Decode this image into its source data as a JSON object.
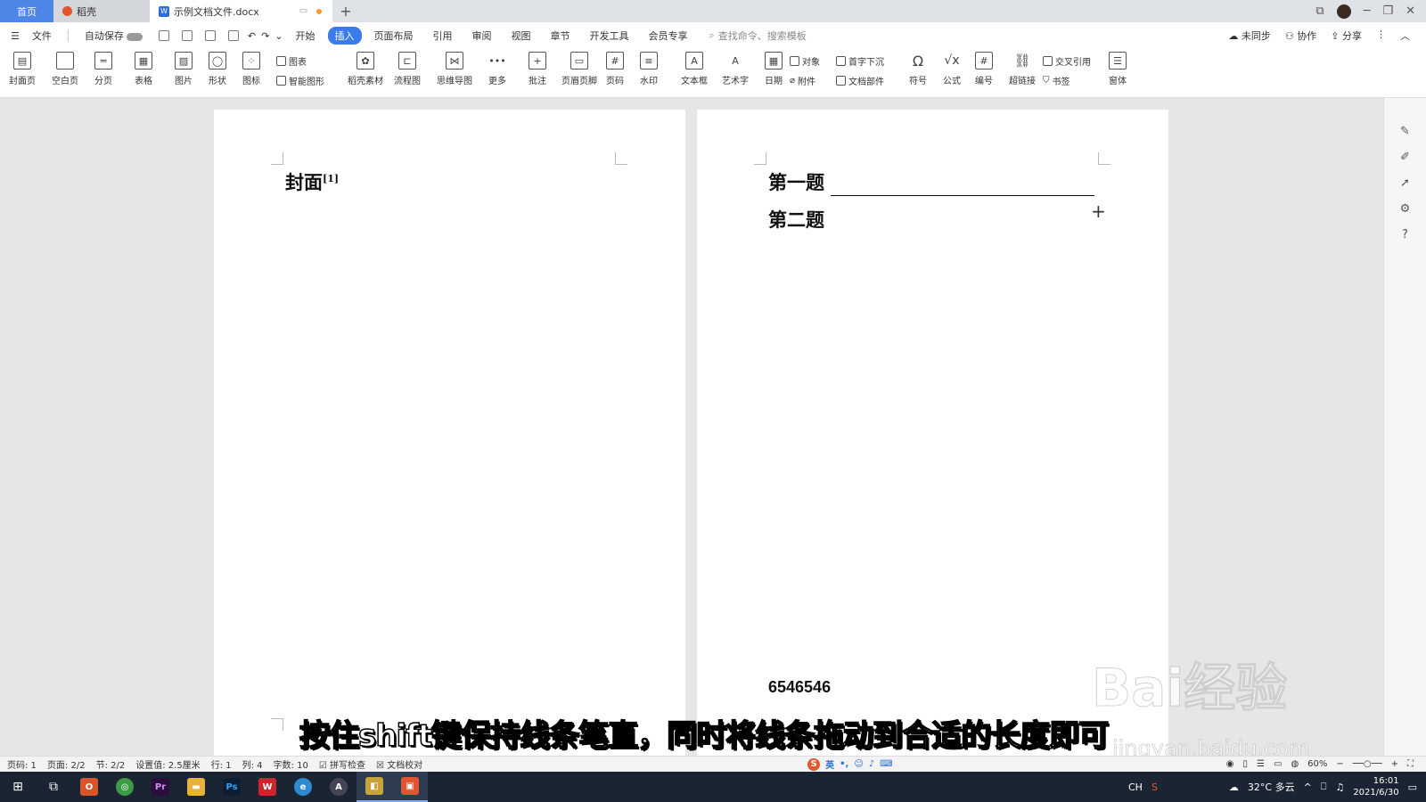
{
  "tabs": {
    "home": "首页",
    "daoke": "稻壳",
    "doc": "示例文档文件.docx"
  },
  "menubar": {
    "file": "文件",
    "autosave": "自动保存",
    "items": [
      "开始",
      "插入",
      "页面布局",
      "引用",
      "审阅",
      "视图",
      "章节",
      "开发工具",
      "会员专享"
    ],
    "active_item": "插入",
    "search_placeholder": "查找命令、搜索模板",
    "sync": "未同步",
    "collab": "协作",
    "share": "分享"
  },
  "ribbon": {
    "cover": "封面页",
    "blank": "空白页",
    "pagebreak": "分页",
    "table": "表格",
    "picture": "图片",
    "shape": "形状",
    "icon": "图标",
    "chart": "图表",
    "smartart": "智能图形",
    "daoke_material": "稻壳素材",
    "flowchart": "流程图",
    "mindmap": "思维导图",
    "more": "更多",
    "comment": "批注",
    "header_footer": "页眉页脚",
    "page_number": "页码",
    "watermark": "水印",
    "textbox": "文本框",
    "wordart": "艺术字",
    "date": "日期",
    "object": "对象",
    "dropcap": "首字下沉",
    "attachment": "附件",
    "docparts": "文档部件",
    "symbol": "符号",
    "formula": "公式",
    "numbering": "编号",
    "hyperlink": "超链接",
    "crossref": "交叉引用",
    "bookmark": "书签",
    "font": "窗体"
  },
  "document": {
    "page1_title": "封面",
    "page1_footnote_ref": "[1]",
    "q1": "第一题",
    "q2": "第二题",
    "bottom_number": "6546546"
  },
  "subtitle": "按住shift键保持线条笔直，同时将线条拖动到合适的长度即可",
  "watermark": {
    "brand": "Bai经验",
    "url": "jingyan.baidu.com"
  },
  "statusbar": {
    "page": "页码: 1",
    "pages": "页面: 2/2",
    "section": "节: 2/2",
    "setting": "设置值: 2.5厘米",
    "row": "行: 1",
    "col": "列: 4",
    "wordcount": "字数: 10",
    "spellcheck": "拼写检查",
    "proofread": "文档校对",
    "ime_lang": "英",
    "zoom": "60%"
  },
  "taskbar": {
    "temperature": "32°C 多云",
    "lang": "CH",
    "time": "16:01",
    "date": "2021/6/30"
  },
  "colors": {
    "accent": "#3b7bea",
    "home_tab": "#4d86e6",
    "taskbar": "#1b2433"
  }
}
